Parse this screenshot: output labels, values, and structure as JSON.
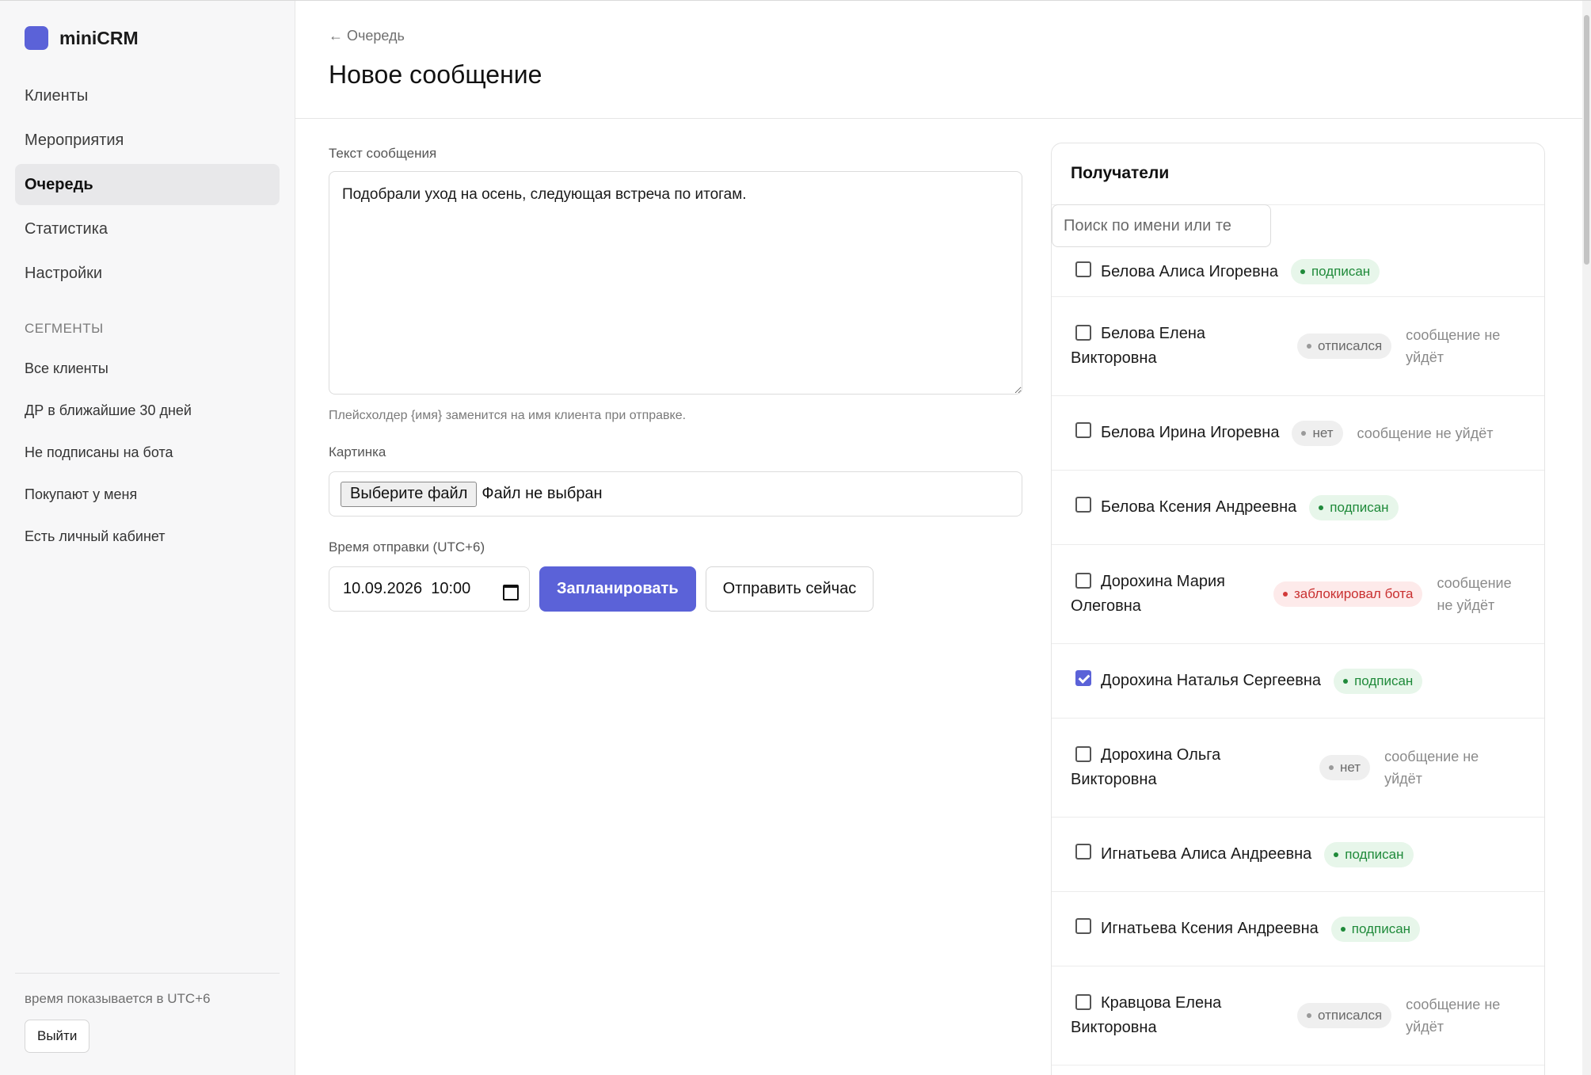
{
  "app": {
    "name": "miniCRM",
    "accent": "#5b62d8"
  },
  "sidebar": {
    "nav": [
      {
        "label": "Клиенты",
        "active": false
      },
      {
        "label": "Мероприятия",
        "active": false
      },
      {
        "label": "Очередь",
        "active": true
      },
      {
        "label": "Статистика",
        "active": false
      },
      {
        "label": "Настройки",
        "active": false
      }
    ],
    "segments_title": "СЕГМЕНТЫ",
    "segments": [
      "Все клиенты",
      "ДР в ближайшие 30 дней",
      "Не подписаны на бота",
      "Покупают у меня",
      "Есть личный кабинет"
    ],
    "tz_note": "время показывается в UTC+6",
    "logout_label": "Выйти"
  },
  "header": {
    "breadcrumb": "← Очередь",
    "title": "Новое сообщение"
  },
  "form": {
    "message_label": "Текст сообщения",
    "message_value": "Подобрали уход на осень, следующая встреча по итогам.",
    "hint": "Плейсхолдер {имя} заменится на имя клиента при отправке.",
    "image_label": "Картинка",
    "file_button": "Выберите файл",
    "file_status": "Файл не выбран",
    "time_label": "Время отправки (UTC+6)",
    "datetime_value": "10.09.2026  10:00",
    "schedule_button": "Запланировать",
    "send_now_button": "Отправить сейчас"
  },
  "recipients": {
    "title": "Получатели",
    "search_placeholder": "Поиск по имени или те",
    "items": [
      {
        "name": "Белова Алиса Игоревна",
        "checked": false,
        "status": "подписан",
        "status_kind": "ok",
        "warning": ""
      },
      {
        "name": "Белова Елена Викторовна",
        "checked": false,
        "status": "отписался",
        "status_kind": "neutral",
        "warning": "сообщение не уйдёт"
      },
      {
        "name": "Белова Ирина Игоревна",
        "checked": false,
        "status": "нет",
        "status_kind": "neutral",
        "warning": "сообщение не уйдёт"
      },
      {
        "name": "Белова Ксения Андреевна",
        "checked": false,
        "status": "подписан",
        "status_kind": "ok",
        "warning": ""
      },
      {
        "name": "Дорохина Мария Олеговна",
        "checked": false,
        "status": "заблокировал бота",
        "status_kind": "blocked",
        "warning": "сообщение не уйдёт"
      },
      {
        "name": "Дорохина Наталья Сергеевна",
        "checked": true,
        "status": "подписан",
        "status_kind": "ok",
        "warning": ""
      },
      {
        "name": "Дорохина Ольга Викторовна",
        "checked": false,
        "status": "нет",
        "status_kind": "neutral",
        "warning": "сообщение не уйдёт"
      },
      {
        "name": "Игнатьева Алиса Андреевна",
        "checked": false,
        "status": "подписан",
        "status_kind": "ok",
        "warning": ""
      },
      {
        "name": "Игнатьева Ксения Андреевна",
        "checked": false,
        "status": "подписан",
        "status_kind": "ok",
        "warning": ""
      },
      {
        "name": "Кравцова Елена Викторовна",
        "checked": false,
        "status": "отписался",
        "status_kind": "neutral",
        "warning": "сообщение не уйдёт"
      }
    ]
  }
}
